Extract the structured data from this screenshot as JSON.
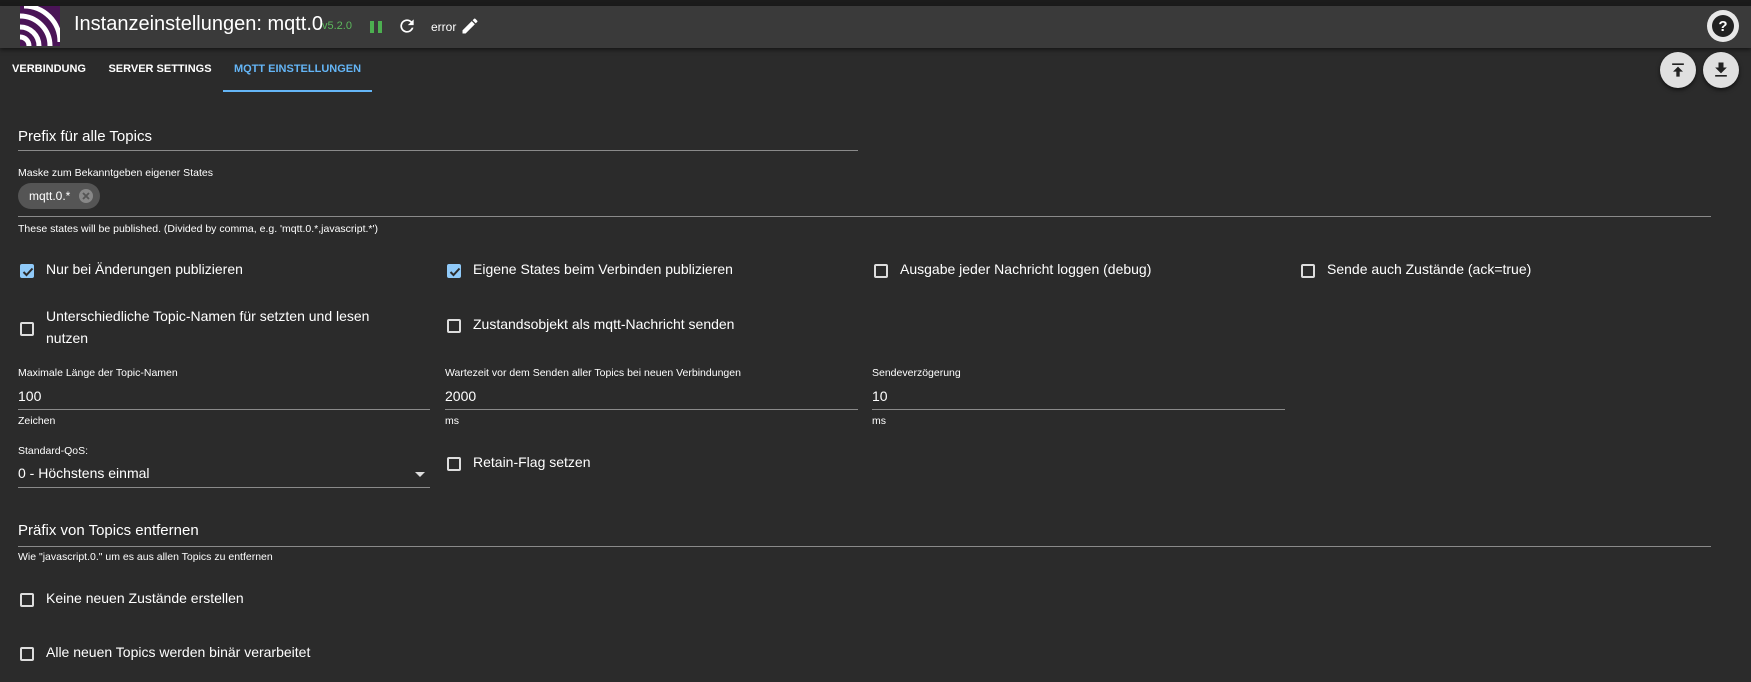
{
  "header": {
    "title": "Instanzeinstellungen: mqtt.0",
    "version": "v5.2.0",
    "status": "error"
  },
  "tabs": [
    {
      "label": "Verbindung"
    },
    {
      "label": "Server settings"
    },
    {
      "label": "MQTT Einstellungen"
    }
  ],
  "form": {
    "prefix_label": "Prefix für alle Topics",
    "mask_label": "Maske zum Bekanntgeben eigener States",
    "mask_chip": "mqtt.0.*",
    "mask_helper": "These states will be published. (Divided by comma, e.g. 'mqtt.0.*,javascript.*')",
    "cb_only_changes": "Nur bei Änderungen publizieren",
    "cb_own_states": "Eigene States beim Verbinden publizieren",
    "cb_debug": "Ausgabe jeder Nachricht loggen (debug)",
    "cb_ack": "Sende auch Zustände (ack=true)",
    "cb_diff_topics_1": "Unterschiedliche Topic-Namen für setzten und lesen",
    "cb_diff_topics_2": "nutzen",
    "cb_state_object": "Zustandsobjekt als mqtt-Nachricht senden",
    "max_len_label": "Maximale Länge der Topic-Namen",
    "max_len_value": "100",
    "max_len_helper": "Zeichen",
    "wait_label": "Wartezeit vor dem Senden aller Topics bei neuen Verbindungen",
    "wait_value": "2000",
    "wait_helper": "ms",
    "delay_label": "Sendeverzögerung",
    "delay_value": "10",
    "delay_helper": "ms",
    "qos_label": "Standard-QoS:",
    "qos_value": "0 - Höchstens einmal",
    "cb_retain": "Retain-Flag setzen",
    "remove_prefix_label": "Präfix von Topics entfernen",
    "remove_prefix_helper": "Wie \"javascript.0.\" um es aus allen Topics zu entfernen",
    "cb_no_new_states": "Keine neuen Zustände erstellen",
    "cb_binary": "Alle neuen Topics werden binär verarbeitet"
  },
  "checked": {
    "only_changes": true,
    "own_states": true,
    "debug": false,
    "ack": false,
    "diff_topics": false,
    "state_object": false,
    "retain": false,
    "no_new_states": false,
    "binary": false
  },
  "colors": {
    "accent": "#64b5f6",
    "background": "#2b2b2b",
    "header": "#3a3a3a",
    "version": "#5cb85c"
  }
}
